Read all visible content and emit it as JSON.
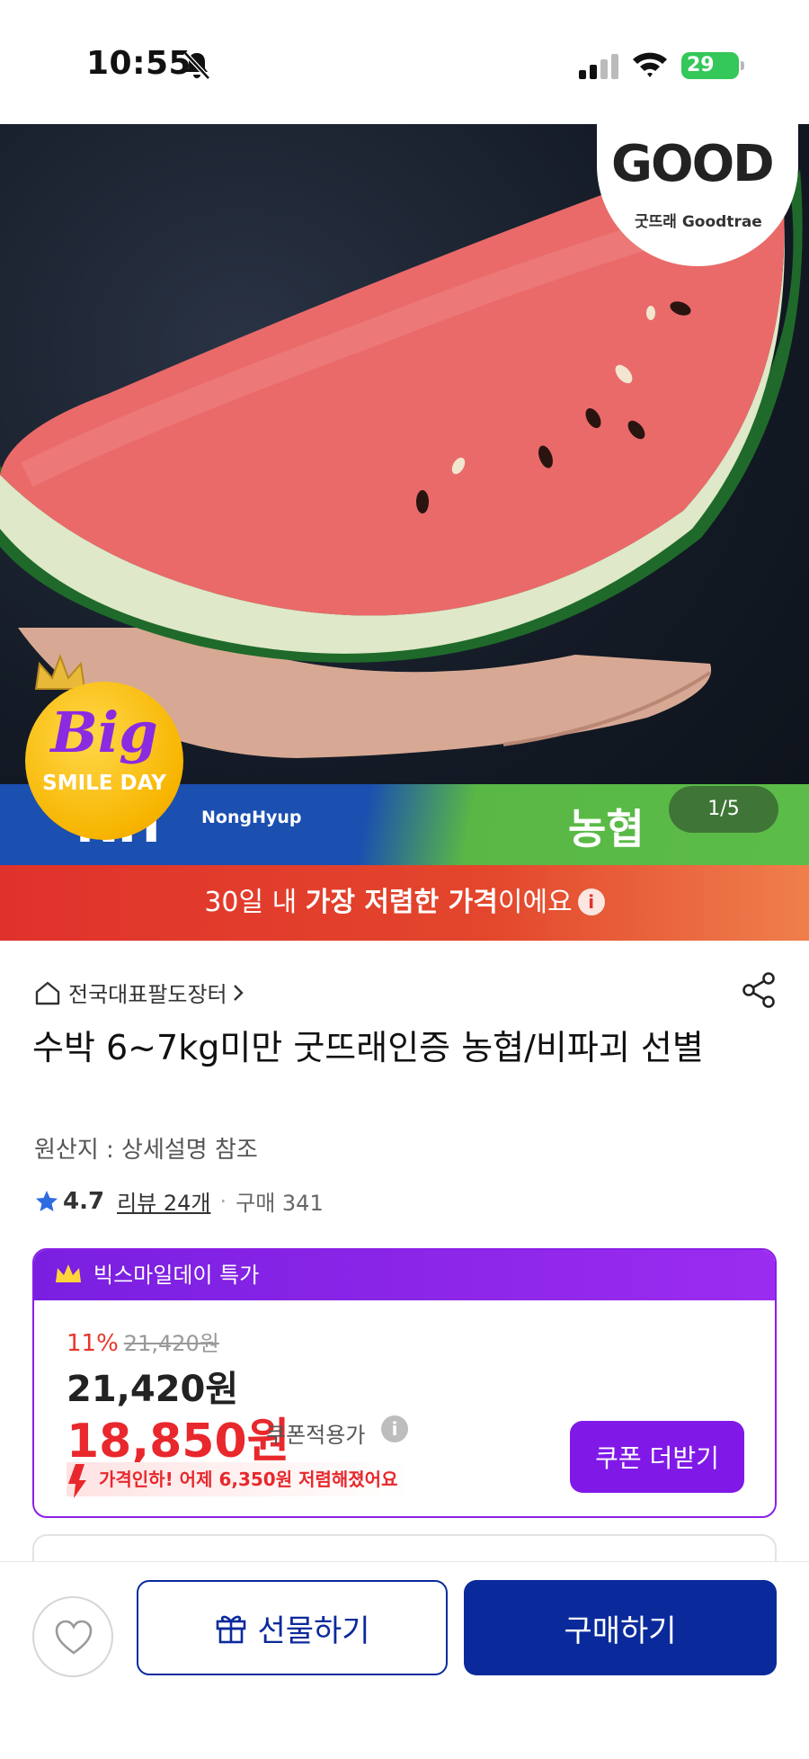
{
  "status_bar": {
    "time": "10:55",
    "battery": "29"
  },
  "hero": {
    "brand_badge": "GOOD",
    "brand_caption": "굿뜨래 Goodtrae",
    "bank_letters": "NH",
    "bank_english": "NongHyup",
    "bank_korean": "농협",
    "event_badge_big": "Big",
    "event_badge_sub": "SMILE DAY",
    "page_indicator": "1/5"
  },
  "notice": {
    "prefix": "30일 내 ",
    "highlight": "가장 저렴한 가격",
    "suffix": "이에요"
  },
  "product": {
    "breadcrumb": "전국대표팔도장터",
    "title": "수박 6~7kg미만 굿뜨래인증 농협/비파괴 선별",
    "origin": "원산지 : 상세설명 참조",
    "rating": "4.7",
    "reviews": "리뷰 24개",
    "purchases": "구매 341"
  },
  "deal": {
    "header": "빅스마일데이 특가",
    "discount_percent": "11%",
    "original_price": "21,420원",
    "sale_price": "21,420원",
    "coupon_price": "18,850원",
    "coupon_label": "쿠폰적용가",
    "price_drop_text": "가격인하! 어제 6,350원 저렴해졌어요",
    "coupon_button": "쿠폰 더받기"
  },
  "bottom_bar": {
    "gift_label": "선물하기",
    "buy_label": "구매하기"
  },
  "colors": {
    "brand_navy": "#0a2a9c",
    "deal_purple": "#8019e8",
    "price_red": "#e8282c",
    "notice_red": "#e0322c"
  }
}
